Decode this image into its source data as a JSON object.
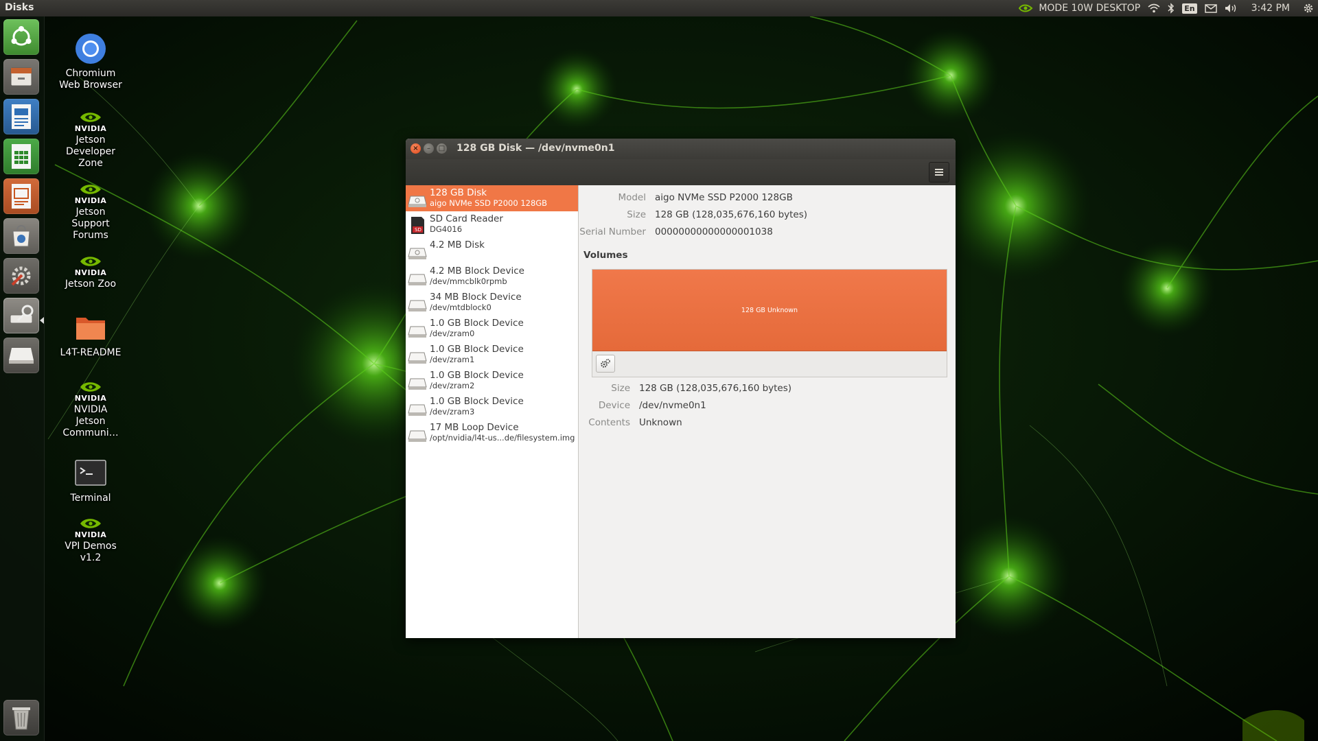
{
  "top_panel": {
    "app_title": "Disks",
    "power_mode": "MODE 10W DESKTOP",
    "keyboard_layout": "En",
    "clock": "3:42 PM",
    "icons": [
      "nvidia-icon",
      "wifi-icon",
      "bluetooth-icon",
      "keyboard-icon",
      "mail-icon",
      "volume-icon",
      "settings-gear-icon"
    ]
  },
  "launcher": {
    "items": [
      {
        "icon": "ubuntu-dash-icon"
      },
      {
        "icon": "file-manager-icon"
      },
      {
        "icon": "writer-document-icon"
      },
      {
        "icon": "calc-spreadsheet-icon"
      },
      {
        "icon": "impress-presentation-icon"
      },
      {
        "icon": "software-center-icon"
      },
      {
        "icon": "system-settings-icon"
      },
      {
        "icon": "disks-utility-icon"
      },
      {
        "icon": "drive-icon"
      },
      {
        "icon": "trash-icon"
      }
    ]
  },
  "desktop": {
    "icons": [
      {
        "label": "Chromium Web Browser",
        "icon": "chromium-icon"
      },
      {
        "label": "Jetson Developer Zone",
        "icon": "nvidia-icon"
      },
      {
        "label": "Jetson Support Forums",
        "icon": "nvidia-icon"
      },
      {
        "label": "Jetson Zoo",
        "icon": "nvidia-icon"
      },
      {
        "label": "L4T-README",
        "icon": "folder-icon"
      },
      {
        "label": "NVIDIA Jetson Communi…",
        "icon": "nvidia-icon"
      },
      {
        "label": "Terminal",
        "icon": "terminal-icon"
      },
      {
        "label": "VPI Demos v1.2",
        "icon": "nvidia-icon"
      }
    ],
    "nvidia_word": "NVIDIA"
  },
  "window": {
    "title": "128 GB Disk — /dev/nvme0n1",
    "menu_icon": "hamburger-menu-icon",
    "devices": [
      {
        "name": "128 GB Disk",
        "sub": "aigo NVMe SSD P2000 128GB",
        "icon": "disk-icon",
        "selected": true
      },
      {
        "name": "SD Card Reader",
        "sub": "DG4016",
        "icon": "sd-card-icon"
      },
      {
        "name": "4.2 MB Disk",
        "sub": "",
        "icon": "disk-icon"
      },
      {
        "name": "4.2 MB Block Device",
        "sub": "/dev/mmcblk0rpmb",
        "icon": "block-device-icon"
      },
      {
        "name": "34 MB Block Device",
        "sub": "/dev/mtdblock0",
        "icon": "block-device-icon"
      },
      {
        "name": "1.0 GB Block Device",
        "sub": "/dev/zram0",
        "icon": "block-device-icon"
      },
      {
        "name": "1.0 GB Block Device",
        "sub": "/dev/zram1",
        "icon": "block-device-icon"
      },
      {
        "name": "1.0 GB Block Device",
        "sub": "/dev/zram2",
        "icon": "block-device-icon"
      },
      {
        "name": "1.0 GB Block Device",
        "sub": "/dev/zram3",
        "icon": "block-device-icon"
      },
      {
        "name": "17 MB Loop Device",
        "sub": "/opt/nvidia/l4t-us...de/filesystem.img",
        "icon": "block-device-icon"
      }
    ],
    "drive_info": {
      "model_label": "Model",
      "model_value": "aigo NVMe SSD P2000 128GB",
      "size_label": "Size",
      "size_value": "128 GB (128,035,676,160 bytes)",
      "serial_label": "Serial Number",
      "serial_value": "00000000000000001038"
    },
    "volumes_heading": "Volumes",
    "volume_block_label": "128 GB Unknown",
    "volume_info": {
      "size_label": "Size",
      "size_value": "128 GB (128,035,676,160 bytes)",
      "device_label": "Device",
      "device_value": "/dev/nvme0n1",
      "contents_label": "Contents",
      "contents_value": "Unknown"
    },
    "accent_color": "#f07746"
  }
}
